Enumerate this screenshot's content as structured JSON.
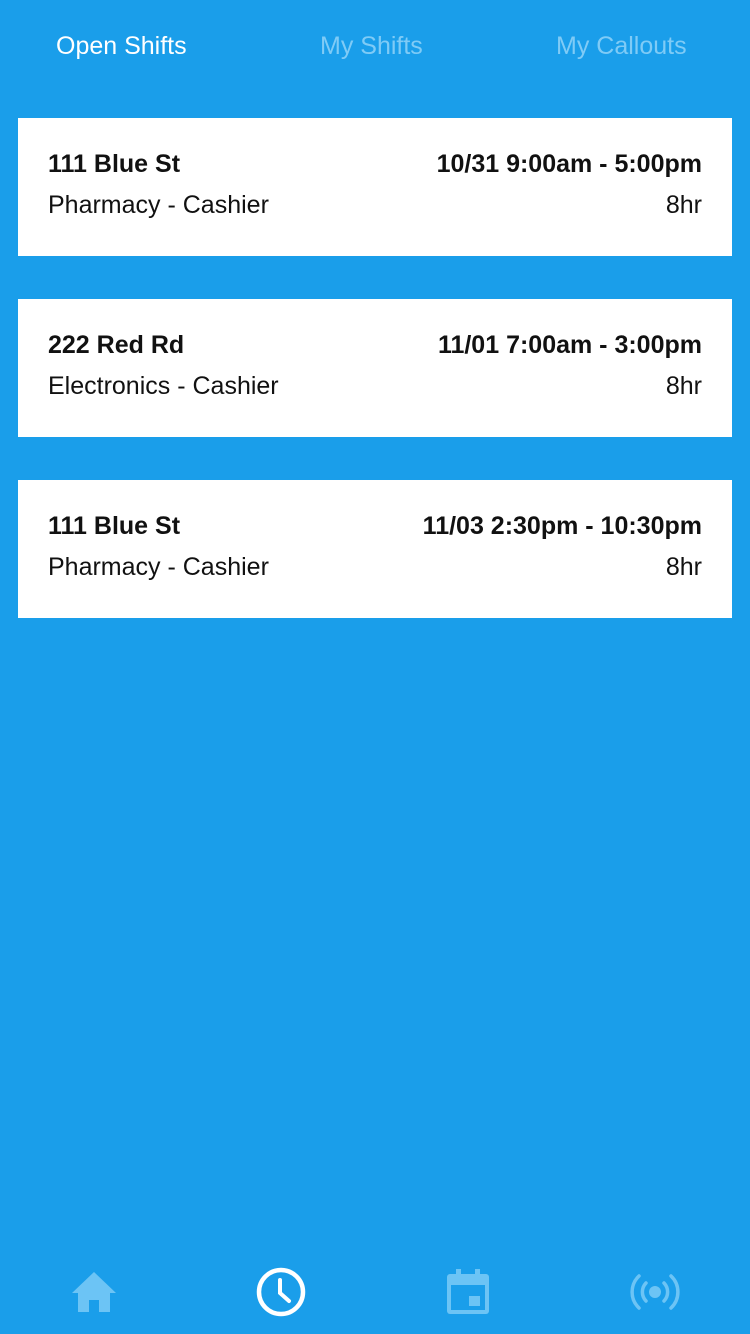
{
  "tabs": [
    {
      "label": "Open Shifts",
      "active": true
    },
    {
      "label": "My Shifts",
      "active": false
    },
    {
      "label": "My Callouts",
      "active": false
    }
  ],
  "shifts": [
    {
      "location": "111 Blue St",
      "time": "10/31 9:00am - 5:00pm",
      "role": "Pharmacy - Cashier",
      "duration": "8hr"
    },
    {
      "location": "222 Red Rd",
      "time": "11/01 7:00am - 3:00pm",
      "role": "Electronics - Cashier",
      "duration": "8hr"
    },
    {
      "location": "111 Blue St",
      "time": "11/03 2:30pm - 10:30pm",
      "role": "Pharmacy - Cashier",
      "duration": "8hr"
    }
  ],
  "bottom_nav": [
    {
      "icon": "home-icon",
      "active": false
    },
    {
      "icon": "clock-icon",
      "active": true
    },
    {
      "icon": "calendar-icon",
      "active": false
    },
    {
      "icon": "broadcast-icon",
      "active": false
    }
  ],
  "colors": {
    "background": "#1A9EEA",
    "tab_active": "#FFFFFF",
    "tab_inactive": "#7FCBF6",
    "card": "#FFFFFF",
    "text": "#111111",
    "nav_active": "#FFFFFF",
    "nav_inactive": "#6CC4F5"
  }
}
